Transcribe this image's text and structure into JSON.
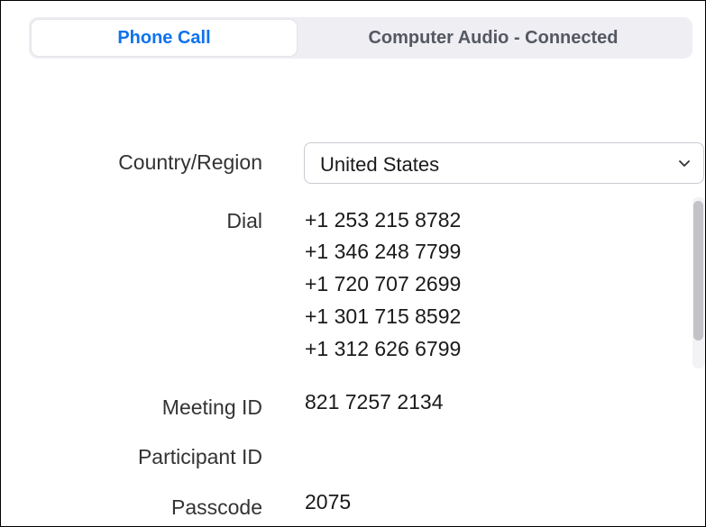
{
  "tabs": [
    {
      "label": "Phone Call",
      "active": true
    },
    {
      "label": "Computer Audio - Connected",
      "active": false
    }
  ],
  "form": {
    "country_label": "Country/Region",
    "country_value": "United States",
    "dial_label": "Dial",
    "dial_numbers": [
      "+1 253 215 8782",
      "+1 346 248 7799",
      "+1 720 707 2699",
      "+1 301 715 8592",
      "+1 312 626 6799"
    ],
    "meeting_id_label": "Meeting ID",
    "meeting_id_value": "821 7257 2134",
    "participant_id_label": "Participant ID",
    "participant_id_value": "",
    "passcode_label": "Passcode",
    "passcode_value": "2075"
  },
  "colors": {
    "accent": "#0e72ed",
    "tab_background": "#eeeef3",
    "inactive_tab_text": "#555862"
  },
  "icons": {
    "dropdown": "chevron-down-icon"
  }
}
